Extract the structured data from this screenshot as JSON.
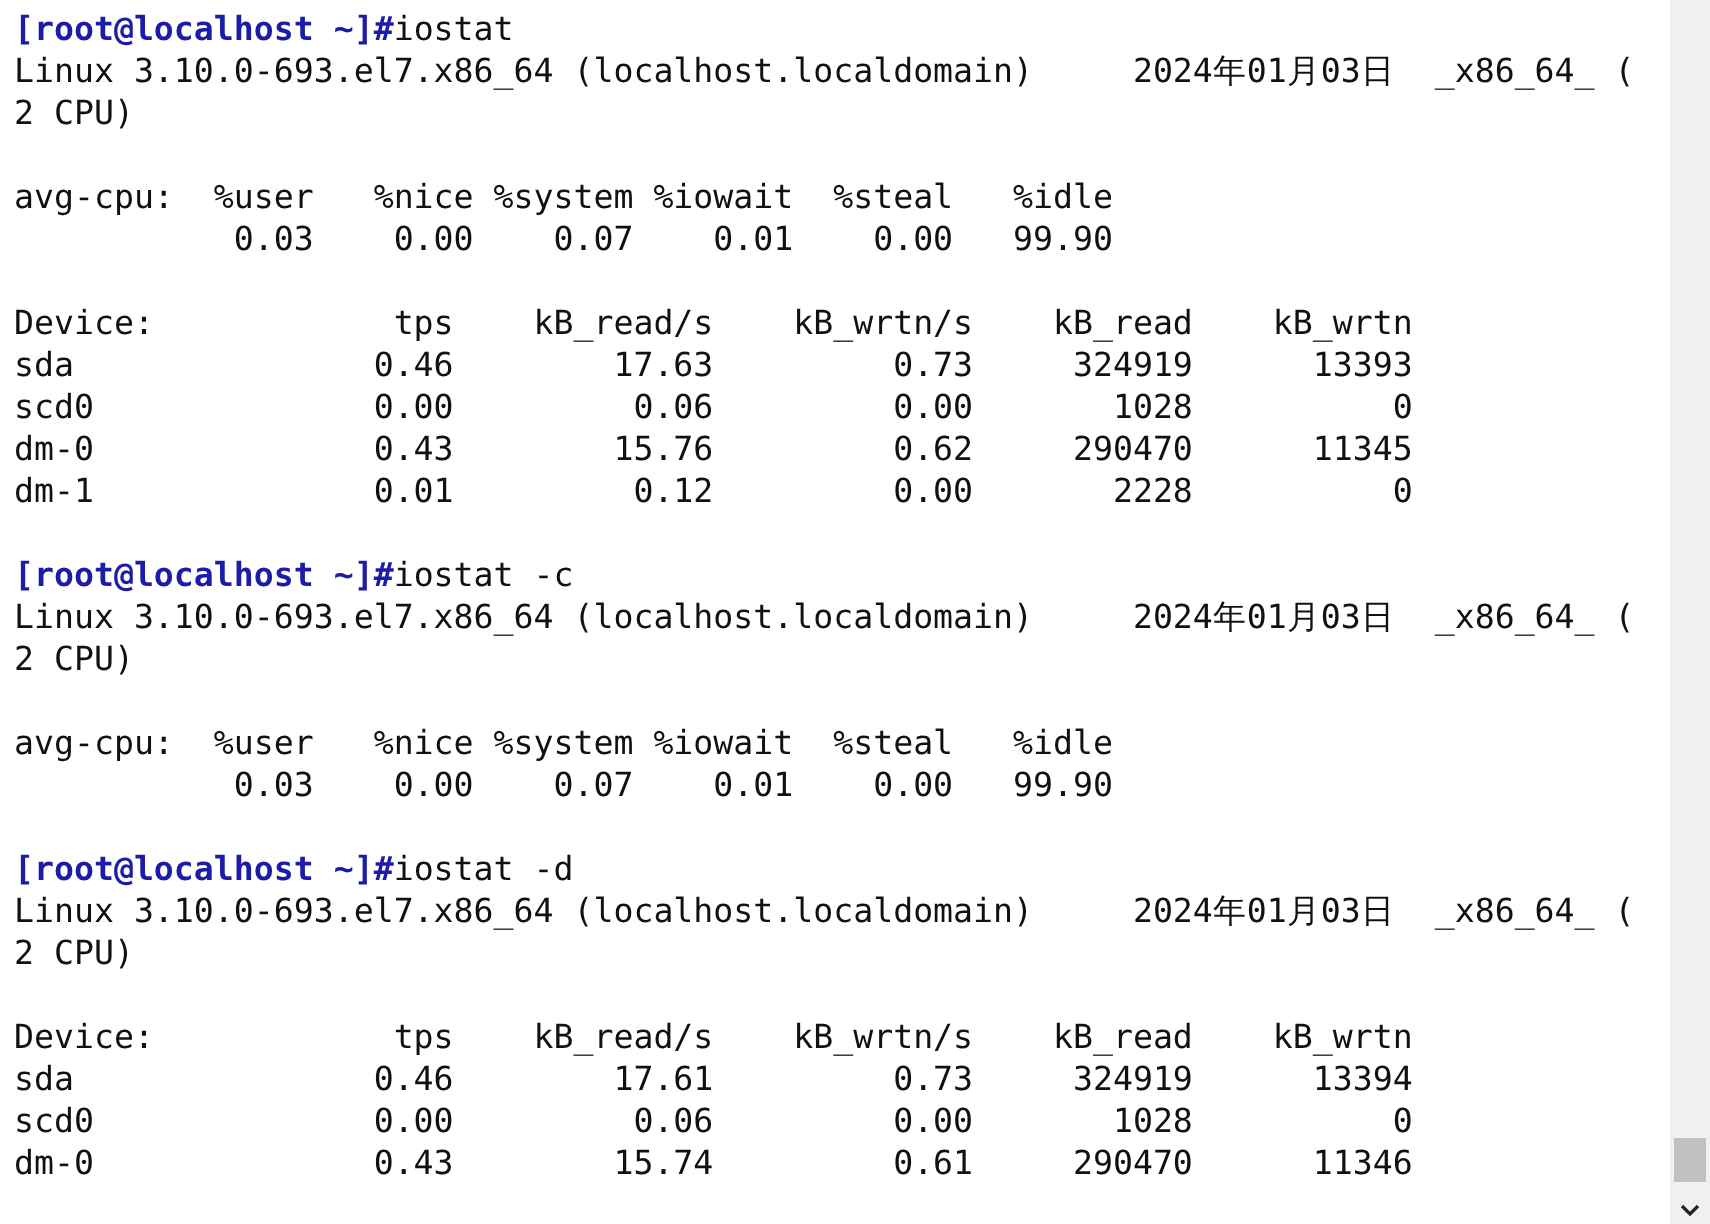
{
  "terminal": {
    "lines": [
      {
        "kind": "prompt",
        "prompt": "[root@localhost ~]#",
        "command": "iostat"
      },
      {
        "kind": "output",
        "text": "Linux 3.10.0-693.el7.x86_64 (localhost.localdomain)     2024年01月03日  _x86_64_ ("
      },
      {
        "kind": "output",
        "text": "2 CPU)"
      },
      {
        "kind": "blank"
      },
      {
        "kind": "output",
        "text": "avg-cpu:  %user   %nice %system %iowait  %steal   %idle"
      },
      {
        "kind": "output",
        "text": "           0.03    0.00    0.07    0.01    0.00   99.90"
      },
      {
        "kind": "blank"
      },
      {
        "kind": "output",
        "text": "Device:            tps    kB_read/s    kB_wrtn/s    kB_read    kB_wrtn"
      },
      {
        "kind": "output",
        "text": "sda               0.46        17.63         0.73     324919      13393"
      },
      {
        "kind": "output",
        "text": "scd0              0.00         0.06         0.00       1028          0"
      },
      {
        "kind": "output",
        "text": "dm-0              0.43        15.76         0.62     290470      11345"
      },
      {
        "kind": "output",
        "text": "dm-1              0.01         0.12         0.00       2228          0"
      },
      {
        "kind": "blank"
      },
      {
        "kind": "prompt",
        "prompt": "[root@localhost ~]#",
        "command": "iostat -c"
      },
      {
        "kind": "output",
        "text": "Linux 3.10.0-693.el7.x86_64 (localhost.localdomain)     2024年01月03日  _x86_64_ ("
      },
      {
        "kind": "output",
        "text": "2 CPU)"
      },
      {
        "kind": "blank"
      },
      {
        "kind": "output",
        "text": "avg-cpu:  %user   %nice %system %iowait  %steal   %idle"
      },
      {
        "kind": "output",
        "text": "           0.03    0.00    0.07    0.01    0.00   99.90"
      },
      {
        "kind": "blank"
      },
      {
        "kind": "prompt",
        "prompt": "[root@localhost ~]#",
        "command": "iostat -d"
      },
      {
        "kind": "output",
        "text": "Linux 3.10.0-693.el7.x86_64 (localhost.localdomain)     2024年01月03日  _x86_64_ ("
      },
      {
        "kind": "output",
        "text": "2 CPU)"
      },
      {
        "kind": "blank"
      },
      {
        "kind": "output",
        "text": "Device:            tps    kB_read/s    kB_wrtn/s    kB_read    kB_wrtn"
      },
      {
        "kind": "output",
        "text": "sda               0.46        17.61         0.73     324919      13394"
      },
      {
        "kind": "output",
        "text": "scd0              0.00         0.06         0.00       1028          0"
      },
      {
        "kind": "output",
        "text": "dm-0              0.43        15.74         0.61     290470      11346"
      }
    ]
  }
}
